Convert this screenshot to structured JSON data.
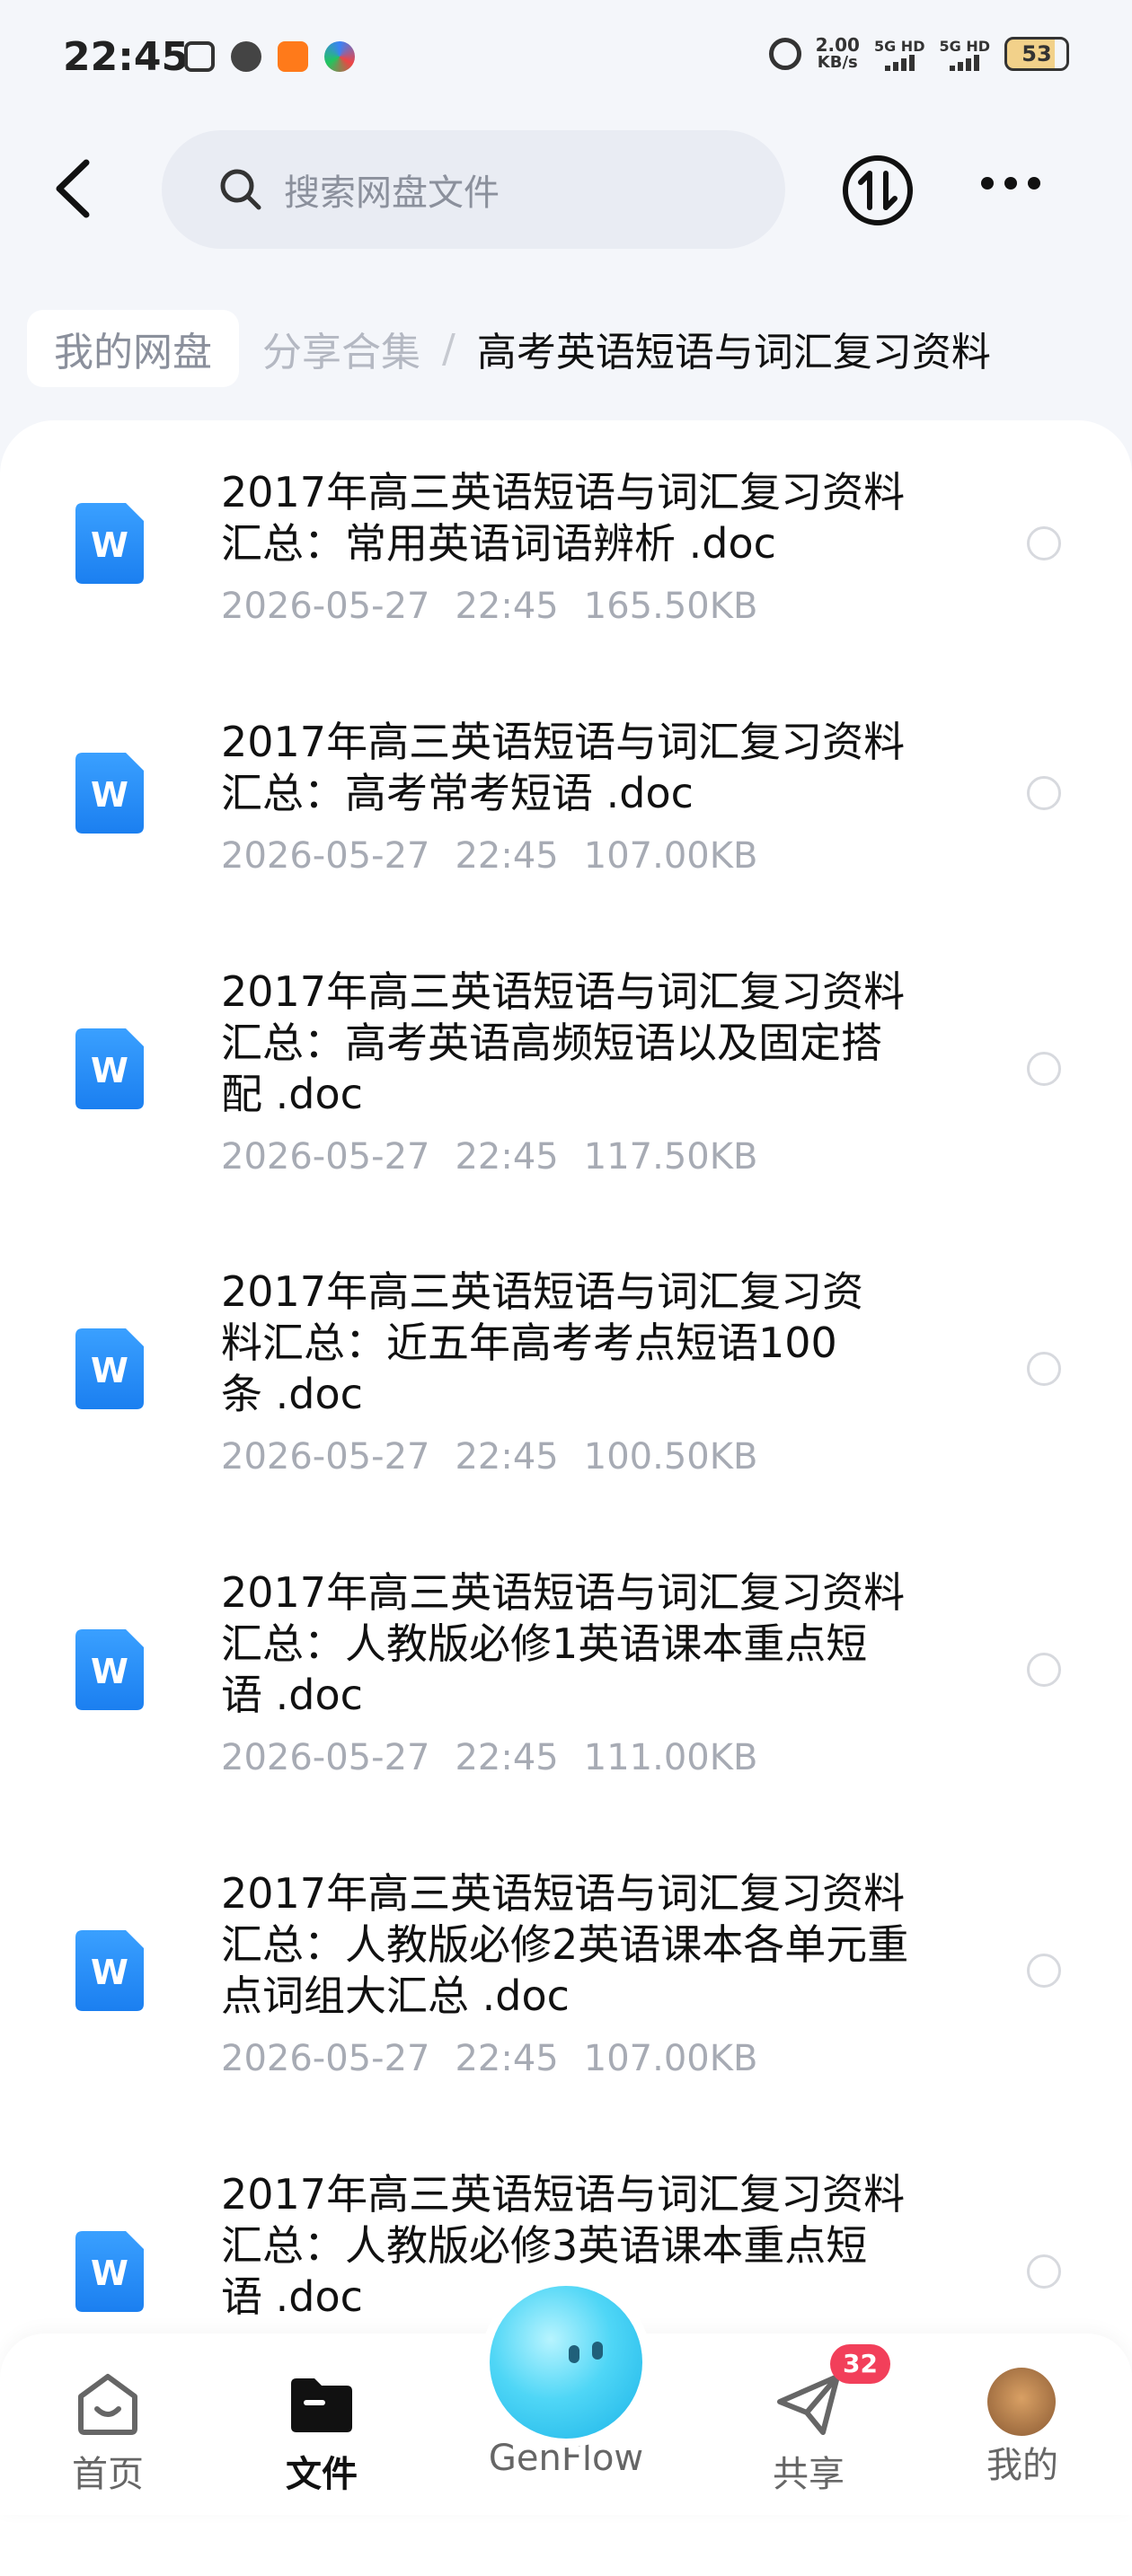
{
  "status_bar": {
    "time": "22:45",
    "net_speed_value": "2.00",
    "net_speed_unit": "KB/s",
    "sim1": "5G HD",
    "sim2": "5G HD",
    "battery": "53"
  },
  "header": {
    "search_placeholder": "搜索网盘文件"
  },
  "breadcrumb": {
    "root": "我的网盘",
    "parent": "分享合集",
    "separator": "/",
    "current": "高考英语短语与词汇复习资料"
  },
  "files": [
    {
      "line1": "2017年高三英语短语与词汇复习资料",
      "line2": "汇总：常用英语词语辨析 .doc",
      "line3": "",
      "date": "2026-05-27",
      "time": "22:45",
      "size": "165.50KB"
    },
    {
      "line1": "2017年高三英语短语与词汇复习资料",
      "line2": "汇总：高考常考短语 .doc",
      "line3": "",
      "date": "2026-05-27",
      "time": "22:45",
      "size": "107.00KB"
    },
    {
      "line1": "2017年高三英语短语与词汇复习资料",
      "line2": "汇总：高考英语高频短语以及固定搭",
      "line3": "配 .doc",
      "date": "2026-05-27",
      "time": "22:45",
      "size": "117.50KB"
    },
    {
      "line1": "2017年高三英语短语与词汇复习资",
      "line2": "料汇总：近五年高考考点短语100",
      "line3": "条 .doc",
      "date": "2026-05-27",
      "time": "22:45",
      "size": "100.50KB"
    },
    {
      "line1": "2017年高三英语短语与词汇复习资料",
      "line2": "汇总：人教版必修1英语课本重点短",
      "line3": "语 .doc",
      "date": "2026-05-27",
      "time": "22:45",
      "size": "111.00KB"
    },
    {
      "line1": "2017年高三英语短语与词汇复习资料",
      "line2": "汇总：人教版必修2英语课本各单元重",
      "line3": "点词组大汇总 .doc",
      "date": "2026-05-27",
      "time": "22:45",
      "size": "107.00KB"
    },
    {
      "line1": "2017年高三英语短语与词汇复习资料",
      "line2": "汇总：人教版必修3英语课本重点短",
      "line3": "语 .doc",
      "date": "",
      "time": "",
      "size": ""
    }
  ],
  "file_icon_letter": "W",
  "nav": {
    "home": "首页",
    "files": "文件",
    "genflow": "GenFlow",
    "share": "共享",
    "share_badge": "32",
    "mine": "我的"
  },
  "colors": {
    "accent": "#2d8cf0",
    "badge": "#f23f5a",
    "meta_text": "#a7abb4"
  }
}
